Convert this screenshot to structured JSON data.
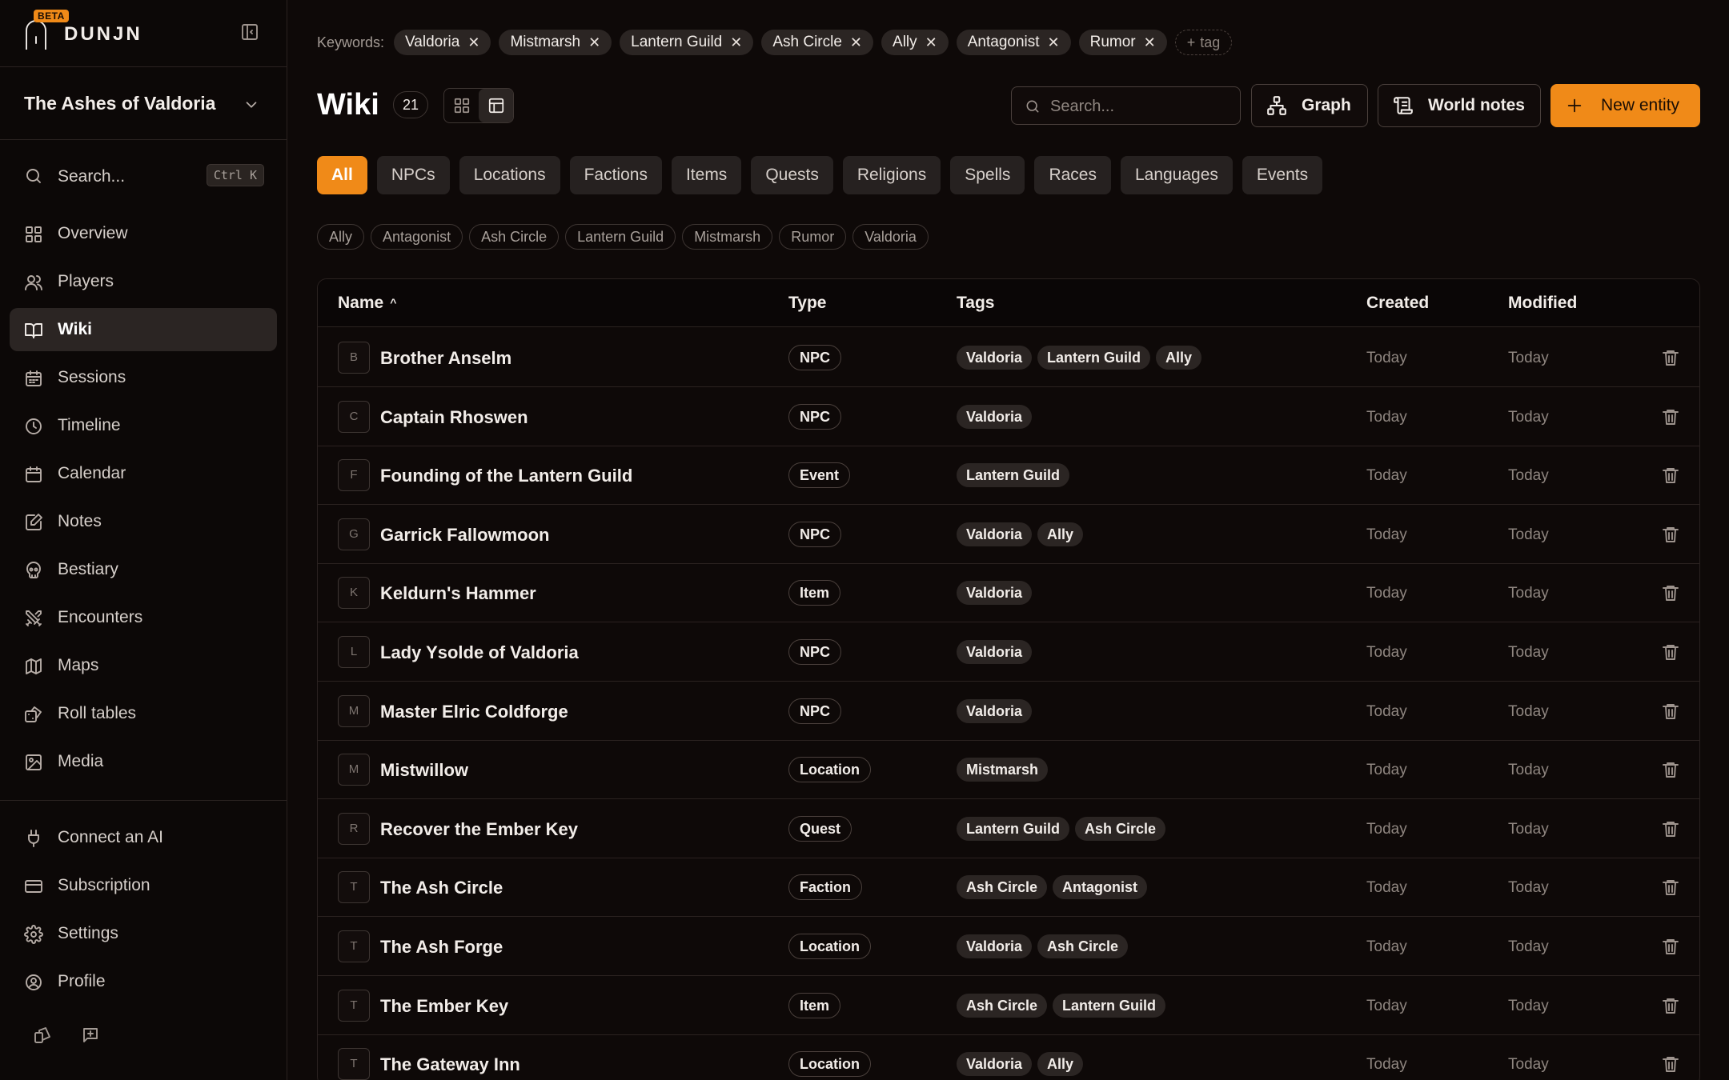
{
  "app": {
    "logo_text": "DUNJN",
    "beta_label": "BETA",
    "campaign_name": "The Ashes of Valdoria"
  },
  "sidebar": {
    "search_label": "Search...",
    "search_shortcut": "Ctrl K",
    "nav": [
      {
        "label": "Overview",
        "icon": "grid-icon"
      },
      {
        "label": "Players",
        "icon": "users-icon"
      },
      {
        "label": "Wiki",
        "icon": "book-icon",
        "active": true
      },
      {
        "label": "Sessions",
        "icon": "calendar-grid-icon"
      },
      {
        "label": "Timeline",
        "icon": "clock-icon"
      },
      {
        "label": "Calendar",
        "icon": "calendar-icon"
      },
      {
        "label": "Notes",
        "icon": "note-icon"
      },
      {
        "label": "Bestiary",
        "icon": "skull-icon"
      },
      {
        "label": "Encounters",
        "icon": "swords-icon"
      },
      {
        "label": "Maps",
        "icon": "map-icon"
      },
      {
        "label": "Roll tables",
        "icon": "dice-icon"
      },
      {
        "label": "Media",
        "icon": "image-icon"
      }
    ],
    "bottom_nav": [
      {
        "label": "Connect an AI",
        "icon": "plug-icon"
      },
      {
        "label": "Subscription",
        "icon": "credit-card-icon"
      },
      {
        "label": "Settings",
        "icon": "gear-icon"
      },
      {
        "label": "Profile",
        "icon": "user-circle-icon"
      }
    ]
  },
  "keywords": {
    "label": "Keywords:",
    "chips": [
      "Valdoria",
      "Mistmarsh",
      "Lantern Guild",
      "Ash Circle",
      "Ally",
      "Antagonist",
      "Rumor"
    ],
    "add_label": "tag"
  },
  "header": {
    "title": "Wiki",
    "count": "21",
    "search_placeholder": "Search...",
    "graph_label": "Graph",
    "world_notes_label": "World notes",
    "new_entity_label": "New entity"
  },
  "filters": [
    "All",
    "NPCs",
    "Locations",
    "Factions",
    "Items",
    "Quests",
    "Religions",
    "Spells",
    "Races",
    "Languages",
    "Events"
  ],
  "active_filter": "All",
  "tag_filters": [
    "Ally",
    "Antagonist",
    "Ash Circle",
    "Lantern Guild",
    "Mistmarsh",
    "Rumor",
    "Valdoria"
  ],
  "table": {
    "columns": {
      "name": "Name",
      "type": "Type",
      "tags": "Tags",
      "created": "Created",
      "modified": "Modified"
    },
    "rows": [
      {
        "initial": "B",
        "name": "Brother Anselm",
        "type": "NPC",
        "tags": [
          "Valdoria",
          "Lantern Guild",
          "Ally"
        ],
        "created": "Today",
        "modified": "Today"
      },
      {
        "initial": "C",
        "name": "Captain Rhoswen",
        "type": "NPC",
        "tags": [
          "Valdoria"
        ],
        "created": "Today",
        "modified": "Today"
      },
      {
        "initial": "F",
        "name": "Founding of the Lantern Guild",
        "type": "Event",
        "tags": [
          "Lantern Guild"
        ],
        "created": "Today",
        "modified": "Today"
      },
      {
        "initial": "G",
        "name": "Garrick Fallowmoon",
        "type": "NPC",
        "tags": [
          "Valdoria",
          "Ally"
        ],
        "created": "Today",
        "modified": "Today"
      },
      {
        "initial": "K",
        "name": "Keldurn's Hammer",
        "type": "Item",
        "tags": [
          "Valdoria"
        ],
        "created": "Today",
        "modified": "Today"
      },
      {
        "initial": "L",
        "name": "Lady Ysolde of Valdoria",
        "type": "NPC",
        "tags": [
          "Valdoria"
        ],
        "created": "Today",
        "modified": "Today"
      },
      {
        "initial": "M",
        "name": "Master Elric Coldforge",
        "type": "NPC",
        "tags": [
          "Valdoria"
        ],
        "created": "Today",
        "modified": "Today"
      },
      {
        "initial": "M",
        "name": "Mistwillow",
        "type": "Location",
        "tags": [
          "Mistmarsh"
        ],
        "created": "Today",
        "modified": "Today"
      },
      {
        "initial": "R",
        "name": "Recover the Ember Key",
        "type": "Quest",
        "tags": [
          "Lantern Guild",
          "Ash Circle"
        ],
        "created": "Today",
        "modified": "Today"
      },
      {
        "initial": "T",
        "name": "The Ash Circle",
        "type": "Faction",
        "tags": [
          "Ash Circle",
          "Antagonist"
        ],
        "created": "Today",
        "modified": "Today"
      },
      {
        "initial": "T",
        "name": "The Ash Forge",
        "type": "Location",
        "tags": [
          "Valdoria",
          "Ash Circle"
        ],
        "created": "Today",
        "modified": "Today"
      },
      {
        "initial": "T",
        "name": "The Ember Key",
        "type": "Item",
        "tags": [
          "Ash Circle",
          "Lantern Guild"
        ],
        "created": "Today",
        "modified": "Today"
      },
      {
        "initial": "T",
        "name": "The Gateway Inn",
        "type": "Location",
        "tags": [
          "Valdoria",
          "Ally"
        ],
        "created": "Today",
        "modified": "Today"
      }
    ]
  },
  "colors": {
    "accent": "#f08a18",
    "background": "#0e0908",
    "chip": "#2b2523"
  }
}
